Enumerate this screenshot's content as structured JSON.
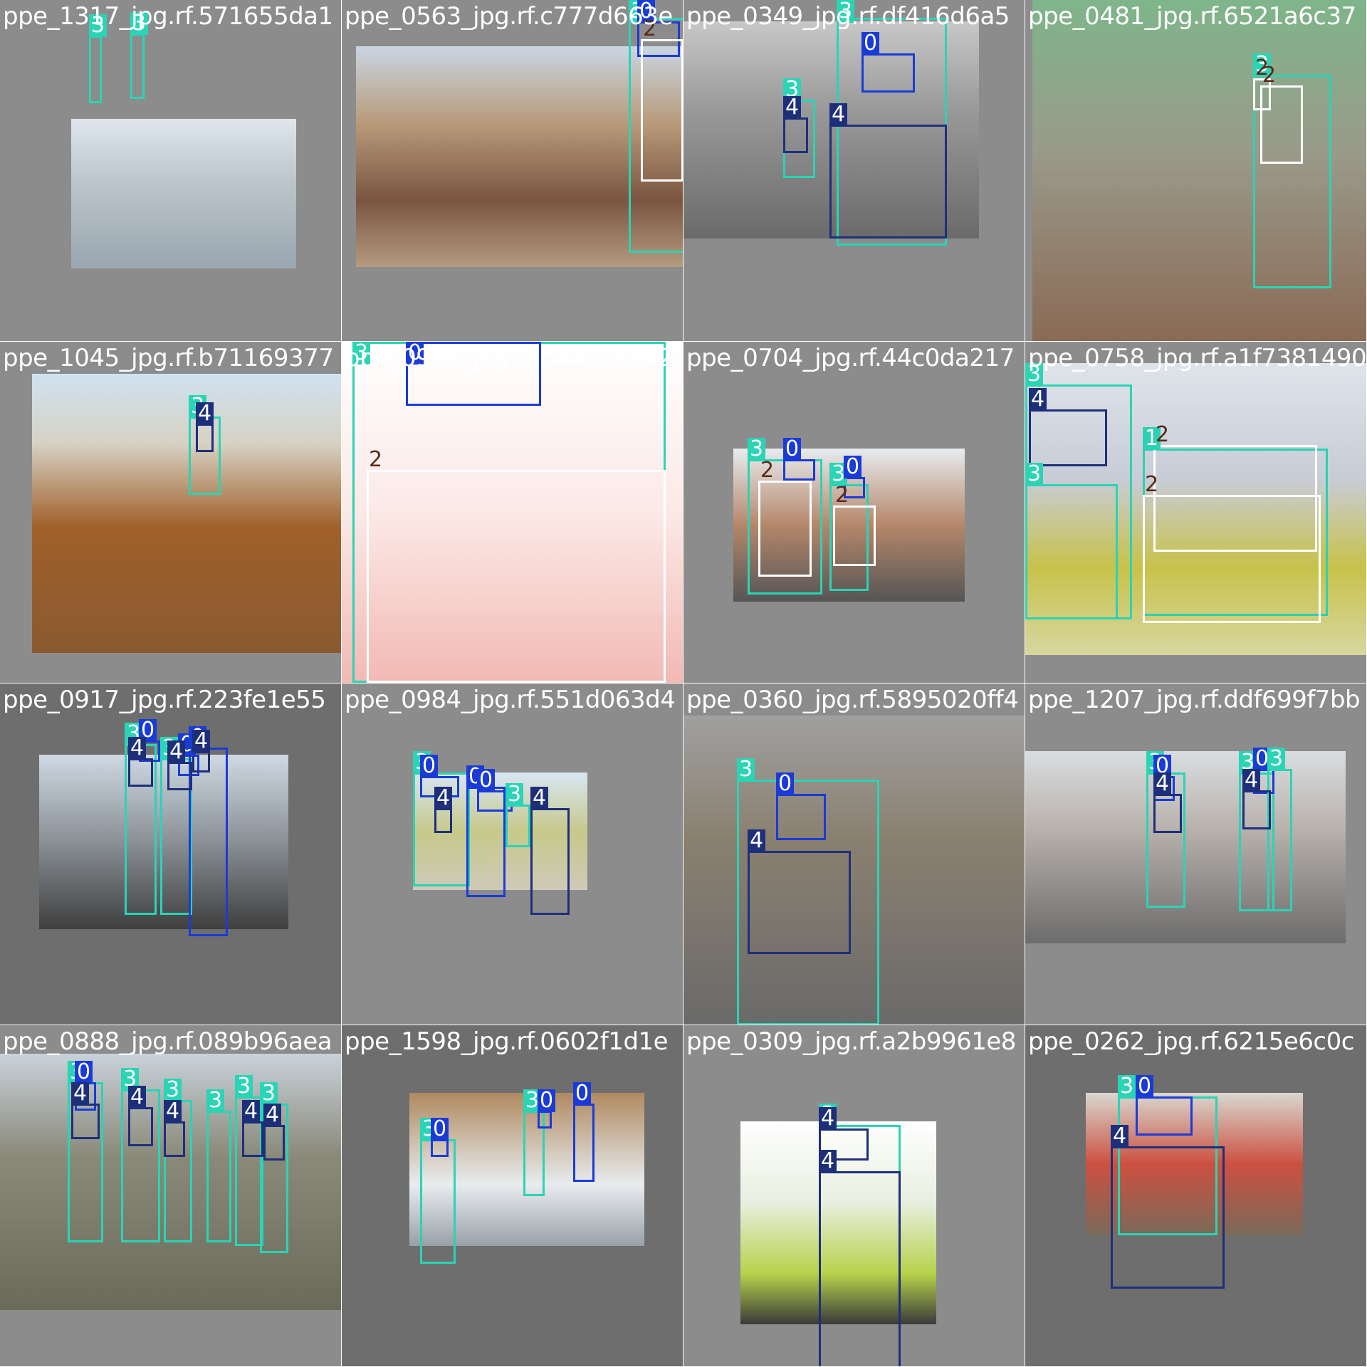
{
  "colors": {
    "class0": "#1a3bd6",
    "class1": "#2bd1b0",
    "class2": "#ffffff",
    "class3": "#2ad4b5",
    "class4": "#1e2f7a"
  },
  "tiles": [
    {
      "filename": "ppe_1317_jpg.rf.571655da1",
      "labels": [
        "3",
        "3"
      ]
    },
    {
      "filename": "ppe_0563_jpg.rf.c777d663e",
      "labels": [
        "3",
        "0",
        "2"
      ]
    },
    {
      "filename": "ppe_0349_jpg.rf.df416d6a5",
      "labels": [
        "3",
        "0",
        "3",
        "4",
        "4"
      ]
    },
    {
      "filename": "ppe_0481_jpg.rf.6521a6c37",
      "labels": [
        "3",
        "2"
      ]
    },
    {
      "filename": "ppe_1045_jpg.rf.b71169377",
      "labels": [
        "3",
        "4"
      ]
    },
    {
      "filename": "ppe_0996_jpg.rf.c44177e42",
      "labels": [
        "3",
        "0",
        "2"
      ]
    },
    {
      "filename": "ppe_0704_jpg.rf.44c0da217",
      "labels": [
        "3",
        "0",
        "2",
        "3",
        "0",
        "2"
      ]
    },
    {
      "filename": "ppe_0758_jpg.rf.a1f7381490",
      "labels": [
        "3",
        "4",
        "3",
        "1",
        "2"
      ]
    },
    {
      "filename": "ppe_0917_jpg.rf.223fe1e55",
      "labels": [
        "3",
        "0",
        "3",
        "0",
        "0",
        "4",
        "4",
        "4"
      ]
    },
    {
      "filename": "ppe_0984_jpg.rf.551d063d4",
      "labels": [
        "3",
        "0",
        "0",
        "0",
        "3",
        "4",
        "4"
      ]
    },
    {
      "filename": "ppe_0360_jpg.rf.5895020ff4",
      "labels": [
        "3",
        "0",
        "4"
      ]
    },
    {
      "filename": "ppe_1207_jpg.rf.ddf699f7bb",
      "labels": [
        "3",
        "0",
        "3",
        "0",
        "3",
        "4",
        "4"
      ]
    },
    {
      "filename": "ppe_0888_jpg.rf.089b96aea",
      "labels": [
        "3",
        "0",
        "3",
        "3",
        "3",
        "3",
        "3",
        "4",
        "4",
        "4",
        "4",
        "4"
      ]
    },
    {
      "filename": "ppe_1598_jpg.rf.0602f1d1e",
      "labels": [
        "3",
        "0",
        "3",
        "0",
        "0"
      ]
    },
    {
      "filename": "ppe_0309_jpg.rf.a2b9961e8",
      "labels": [
        "3",
        "4"
      ]
    },
    {
      "filename": "ppe_0262_jpg.rf.6215e6c0c",
      "labels": [
        "3",
        "0",
        "4"
      ]
    }
  ]
}
